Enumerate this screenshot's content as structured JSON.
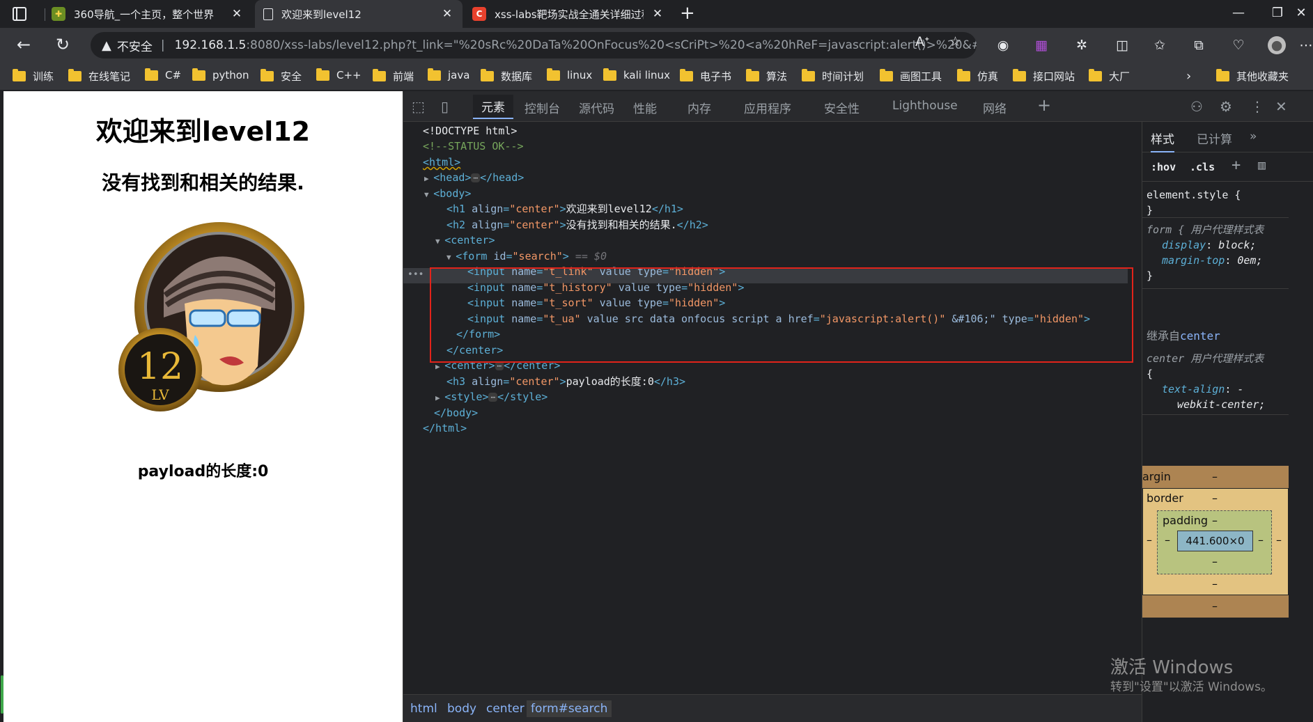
{
  "tabs": [
    {
      "title": "360导航_一个主页，整个世界",
      "active": false
    },
    {
      "title": "欢迎来到level12",
      "active": true
    },
    {
      "title": "xss-labs靶场实战全通关详细过程",
      "active": false
    }
  ],
  "window": {
    "minimize": "—",
    "restore": "❐",
    "close": "✕"
  },
  "address": {
    "insecure_label": "不安全",
    "url_host": "192.168.1.5",
    "url_rest": ":8080/xss-labs/level12.php?t_link=\"%20sRc%20DaTa%20OnFocus%20<sCriPt>%20<a%20hReF=javascript:alert()>%20&#..."
  },
  "bookmarks": [
    "训练",
    "在线笔记",
    "C#",
    "python",
    "安全",
    "C++",
    "前端",
    "java",
    "数据库",
    "linux",
    "kali linux",
    "电子书",
    "算法",
    "时间计划",
    "画图工具",
    "仿真",
    "接口网站",
    "大厂",
    "其他收藏夹"
  ],
  "page": {
    "h1": "欢迎来到level12",
    "h2": "没有找到和相关的结果.",
    "h3": "payload的长度:0",
    "badge_number": "12",
    "badge_level": "LV"
  },
  "devtools": {
    "tabs": [
      "元素",
      "控制台",
      "源代码",
      "性能",
      "内存",
      "应用程序",
      "安全性",
      "Lighthouse",
      "网络"
    ],
    "code": {
      "doctype": "<!DOCTYPE html>",
      "comment": "<!--STATUS OK-->",
      "html_open": "<html>",
      "head_open": "<head>",
      "head_close": "</head>",
      "body_open": "<body>",
      "h1_open": "<h1",
      "h1_text": "欢迎来到level12",
      "h1_close": "</h1>",
      "h2_open": "<h2",
      "h2_text": "没有找到和相关的结果.",
      "h2_close": "</h2>",
      "center_open": "<center>",
      "form_open": "<form",
      "form_id_val": "\"search\"",
      "form_eq": "== $0",
      "input_open": "<input",
      "name_t_link": "\"t_link\"",
      "name_t_history": "\"t_history\"",
      "name_t_sort": "\"t_sort\"",
      "name_t_ua": "\"t_ua\"",
      "ua_attrs": "value src data onfocus script a href",
      "ua_href_val": "\"javascript:alert()\"",
      "ua_tail": "&#106;\"",
      "type_hidden": "\"hidden\"",
      "form_close": "</form>",
      "center_close": "</center>",
      "h3_open": "<h3",
      "h3_text": "payload的长度:0",
      "h3_close": "</h3>",
      "style_open": "<style>",
      "style_close": "</style>",
      "body_close": "</body>",
      "html_close": "</html>",
      "align_center": "\"center\""
    },
    "breadcrumbs": [
      "html",
      "body",
      "center",
      "form#search"
    ],
    "styles": {
      "tabs": [
        "样式",
        "已计算"
      ],
      "hov": ":hov",
      "cls": ".cls",
      "element_style": "element.style {",
      "rule_form_selector": "form {",
      "rule_source": "用户代理样式表",
      "form_props": [
        [
          "display",
          "block;"
        ],
        [
          "margin-top",
          "0em;"
        ]
      ],
      "inherited_label": "继承自",
      "inherited_from": "center",
      "center_selector": "center",
      "center_prop": "text-align",
      "center_val_1": "-",
      "center_val_2": "webkit-center;",
      "box_margin": "argin",
      "box_border": "border",
      "box_padding": "padding",
      "box_content": "441.600×0",
      "dash": "–"
    }
  },
  "watermark": {
    "line1": "激活 Windows",
    "line2": "转到\"设置\"以激活 Windows。"
  }
}
